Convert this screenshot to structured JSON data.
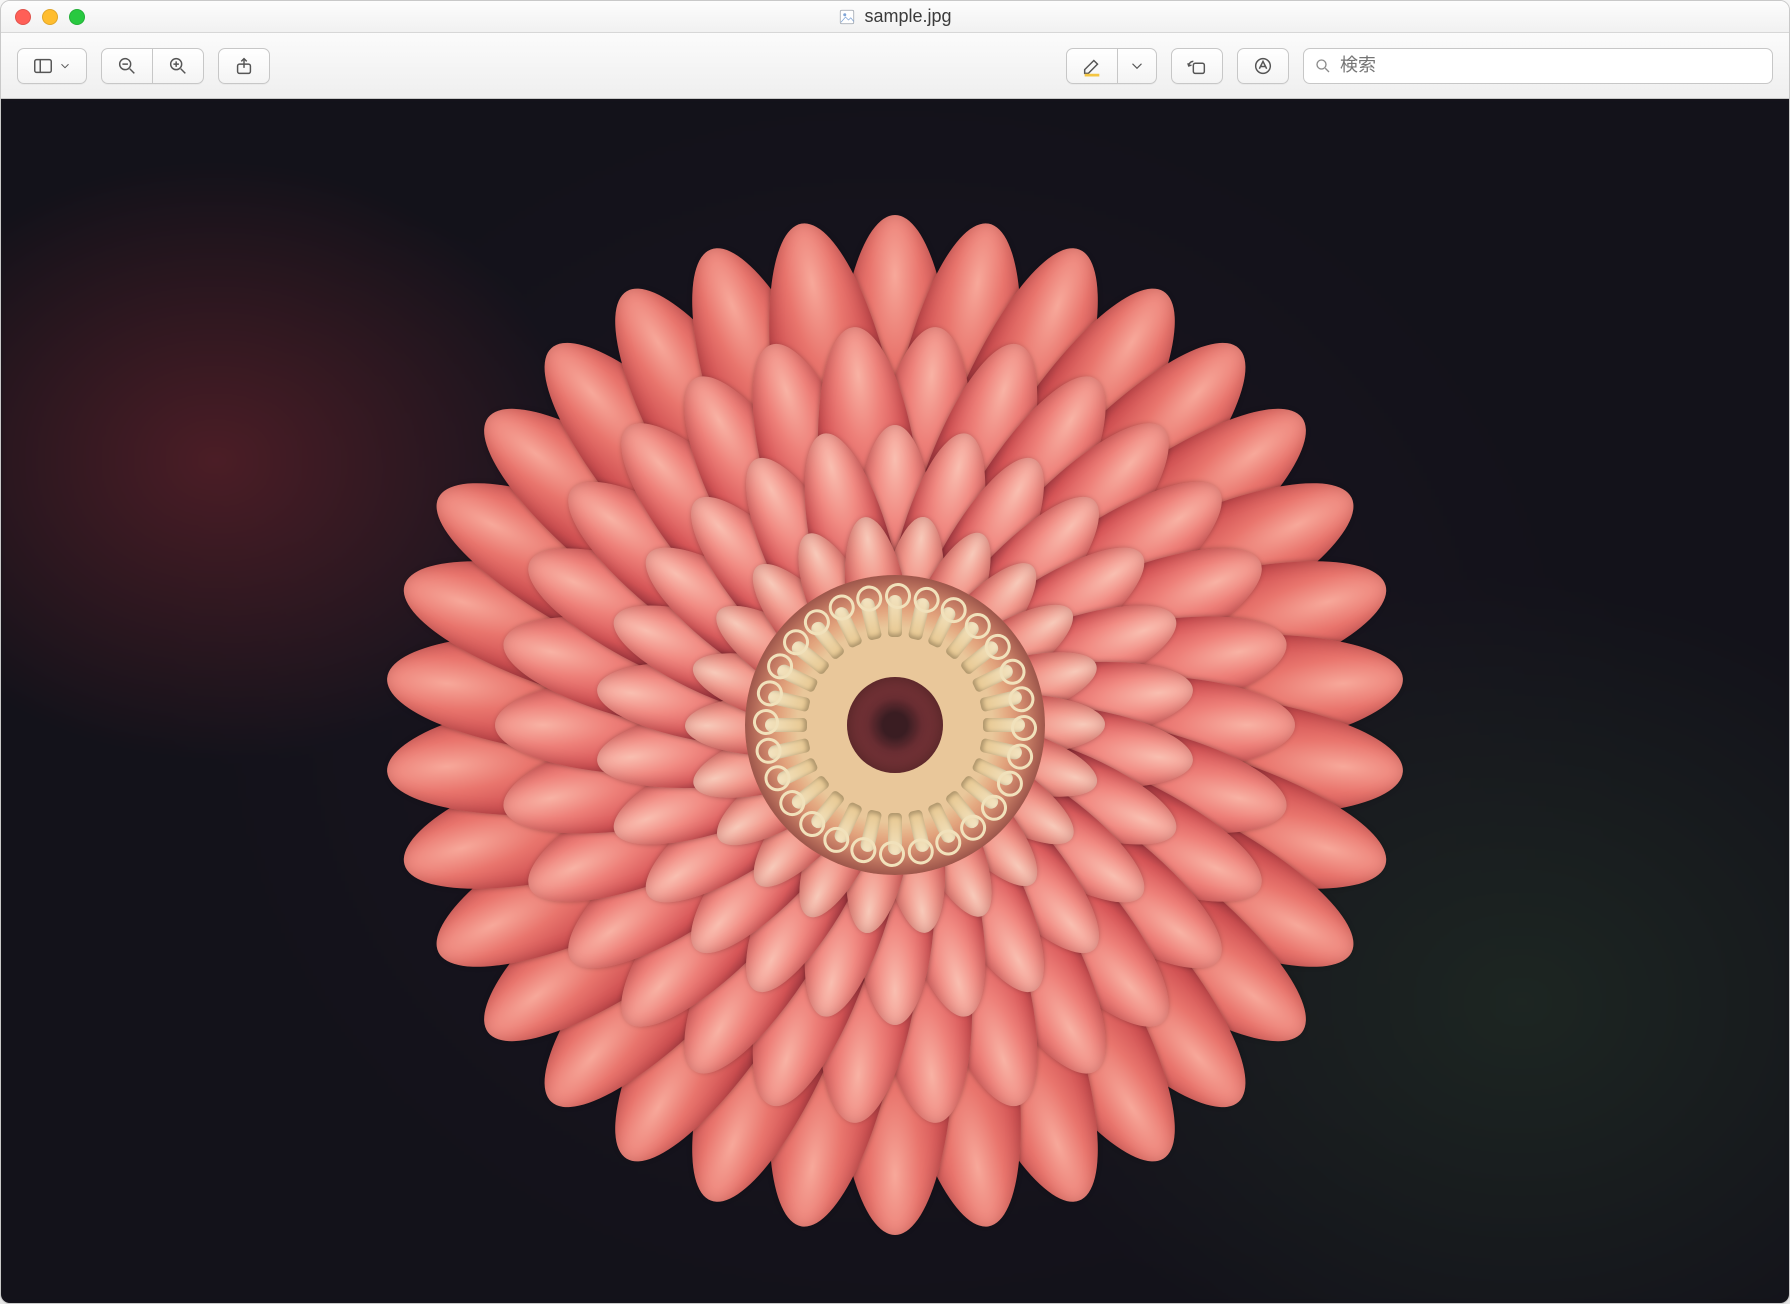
{
  "window": {
    "title": "sample.jpg",
    "file_icon": "image-file-icon"
  },
  "traffic": {
    "close": "close",
    "minimize": "minimize",
    "zoom": "zoom"
  },
  "toolbar": {
    "sidebar_dropdown": "sidebar",
    "zoom_out": "zoom out",
    "zoom_in": "zoom in",
    "share": "share",
    "markup": "markup",
    "markup_menu": "markup options",
    "rotate": "rotate left",
    "annotate": "annotate circle"
  },
  "search": {
    "placeholder": "検索"
  },
  "image": {
    "subject": "flower",
    "dominant_colors": [
      "#e9756d",
      "#cf4f51",
      "#17161d"
    ]
  }
}
